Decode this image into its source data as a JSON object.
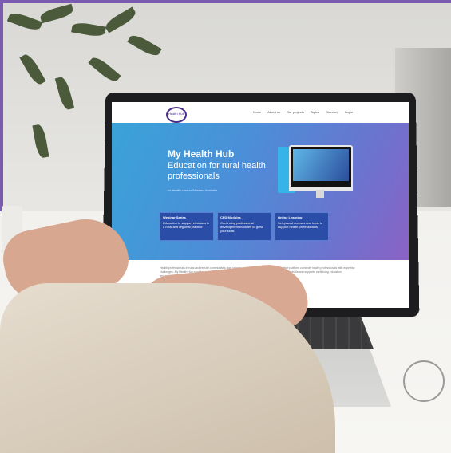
{
  "website": {
    "nav_items": [
      "Home",
      "About us",
      "Our projects",
      "Topics",
      "Directory",
      "Login"
    ],
    "logo_text": "Health Hub",
    "hero_title": "My Health Hub",
    "hero_subtitle": "Education for rural health professionals",
    "hero_small": "for health care in Western Australia",
    "cards": [
      {
        "title": "Webinar Series",
        "text": "Education to support clinicians in a rural and regional practice"
      },
      {
        "title": "CPD Modules",
        "text": "Continuing professional development modules to grow your skills"
      },
      {
        "title": "Online Learning",
        "text": "Self-paced courses and tools to support health professionals"
      }
    ],
    "content_left": "Health professionals in rural and remote communities face unique challenges. My Health Hub provides access to quality education resources and networking opportunities.",
    "content_right": "Our collaborative platform connects health professionals with expertise across Western Australia and supports continuing education."
  },
  "colors": {
    "accent_border": "#7b5bb0",
    "hero_gradient_start": "#3aa3d8",
    "hero_gradient_end": "#8b62c4"
  }
}
